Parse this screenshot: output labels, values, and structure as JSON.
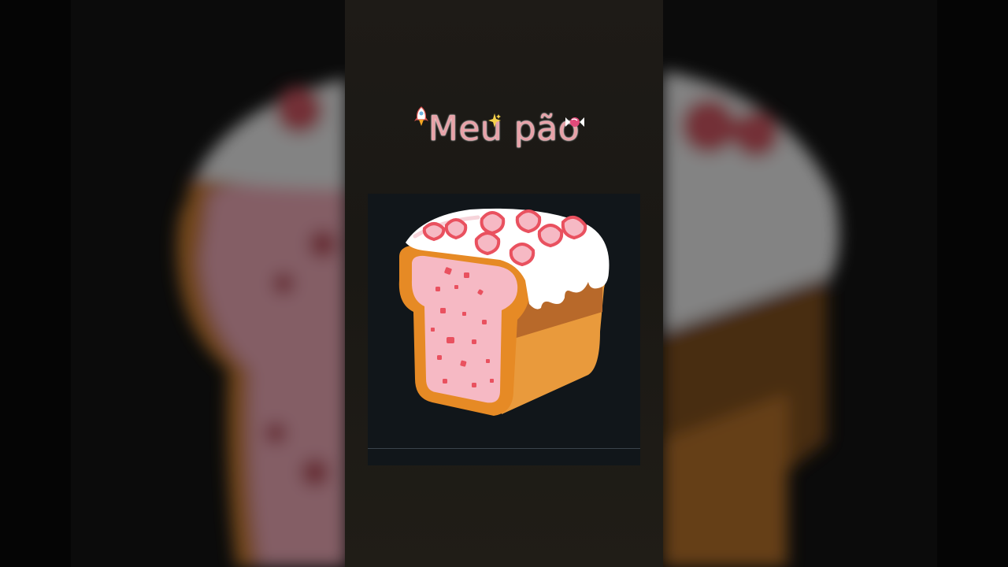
{
  "title": {
    "text": "Meu pão",
    "color": "#e8a2a8"
  },
  "decorations": {
    "left_icon": "rocket-sticker-icon",
    "middle_icon": "sparkle-icon",
    "right_icon": "candy-icon"
  },
  "image": {
    "subject": "bread-loaf-icon",
    "colors": {
      "crust": "#e99a3c",
      "crumb": "#f6b9c4",
      "icing": "#ffffff",
      "strawberry": "#e9515f",
      "background": "#11161a"
    }
  },
  "colors": {
    "page_background": "#000000",
    "panel_background": "#1e1b17"
  }
}
